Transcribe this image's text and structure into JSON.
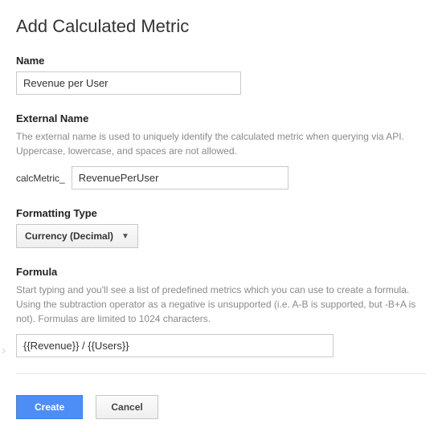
{
  "page": {
    "title": "Add Calculated Metric"
  },
  "name": {
    "label": "Name",
    "value": "Revenue per User"
  },
  "external": {
    "label": "External Name",
    "help": "The external name is used to uniquely identify the calculated metric when querying via API. Uppercase, lowercase, and spaces are not allowed.",
    "prefix": "calcMetric_",
    "value": "RevenuePerUser"
  },
  "format": {
    "label": "Formatting Type",
    "selected": "Currency (Decimal)"
  },
  "formula": {
    "label": "Formula",
    "help": "Start typing and you'll see a list of predefined metrics which you can use to create a formula. Using the subtraction operator as a negative is unsupported (i.e. A-B is supported, but -B+A is not). Formulas are limited to 1024 characters.",
    "value": "{{Revenue}} / {{Users}}"
  },
  "actions": {
    "create": "Create",
    "cancel": "Cancel"
  }
}
